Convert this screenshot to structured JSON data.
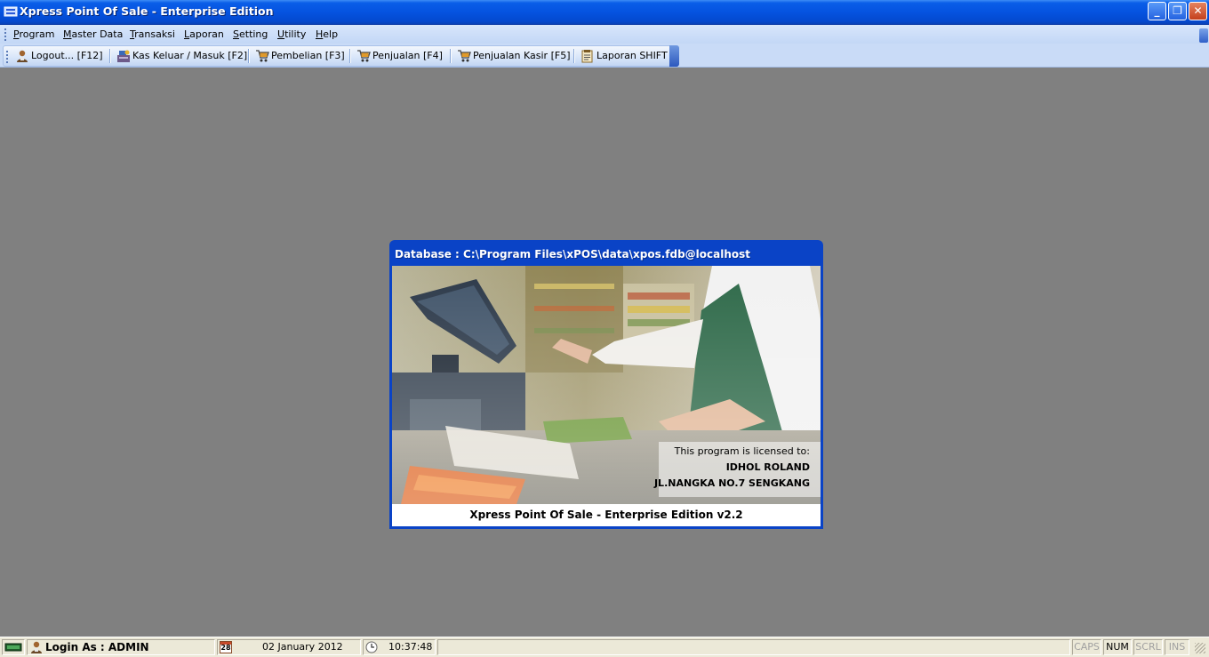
{
  "window": {
    "title": "Xpress Point Of Sale - Enterprise Edition",
    "min_glyph": "_",
    "max_glyph": "❐",
    "close_glyph": "✕"
  },
  "menu": {
    "items": [
      {
        "label": "Program",
        "accel": "P",
        "rest": "rogram"
      },
      {
        "label": "Master Data",
        "accel": "M",
        "rest": "aster Data"
      },
      {
        "label": "Transaksi",
        "accel": "T",
        "rest": "ransaksi"
      },
      {
        "label": "Laporan",
        "accel": "L",
        "rest": "aporan"
      },
      {
        "label": "Setting",
        "accel": "S",
        "rest": "etting"
      },
      {
        "label": "Utility",
        "accel": "U",
        "rest": "tility"
      },
      {
        "label": "Help",
        "accel": "H",
        "rest": "elp"
      }
    ]
  },
  "toolbar": {
    "logout": {
      "label": "Logout...  [F12]",
      "icon": "user-icon"
    },
    "kas": {
      "label": "Kas Keluar / Masuk  [F2]",
      "icon": "cash-register-icon"
    },
    "pembelian": {
      "label": "Pembelian  [F3]",
      "icon": "cart-icon"
    },
    "penjualan": {
      "label": "Penjualan  [F4]",
      "icon": "cart-icon"
    },
    "penjualan_kasir": {
      "label": "Penjualan Kasir  [F5]",
      "icon": "cart-icon"
    },
    "laporan_shift": {
      "label": "Laporan SHIFT",
      "icon": "report-icon"
    }
  },
  "splash": {
    "title": "Database : C:\\Program Files\\xPOS\\data\\xpos.fdb@localhost",
    "license_heading": "This program is licensed to:",
    "licensee_name": "IDHOL ROLAND",
    "licensee_address": "JL.NANGKA NO.7 SENGKANG",
    "version": "Xpress Point Of Sale - Enterprise Edition v2.2"
  },
  "statusbar": {
    "login": "Login As : ADMIN",
    "calendar_day": "28",
    "date": "02 January 2012",
    "time": "10:37:48",
    "caps": "CAPS",
    "num": "NUM",
    "scrl": "SCRL",
    "ins": "INS"
  }
}
